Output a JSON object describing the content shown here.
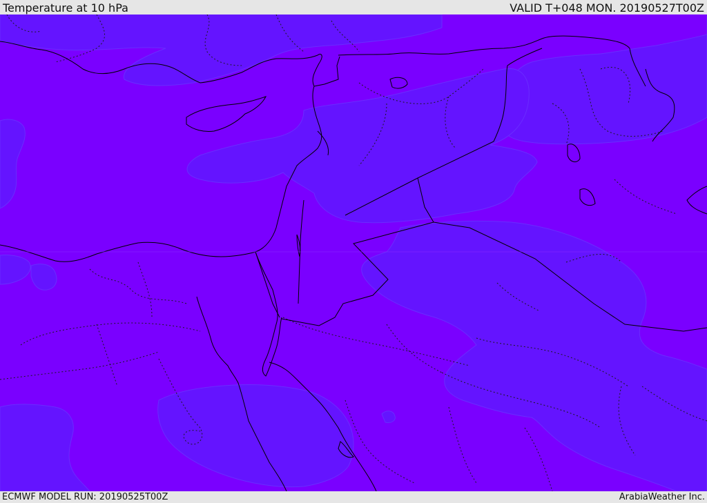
{
  "header": {
    "title": "Temperature at 10 hPa",
    "valid": "VALID T+048 MON. 20190527T00Z"
  },
  "footer": {
    "model_run": "ECMWF MODEL RUN: 20190525T00Z",
    "credit": "ArabiaWeather Inc."
  },
  "colors": {
    "field_warm": "#7a00ff",
    "field_cool": "#6414ff",
    "coastline": "#000000",
    "background": "#e6e6e6"
  }
}
